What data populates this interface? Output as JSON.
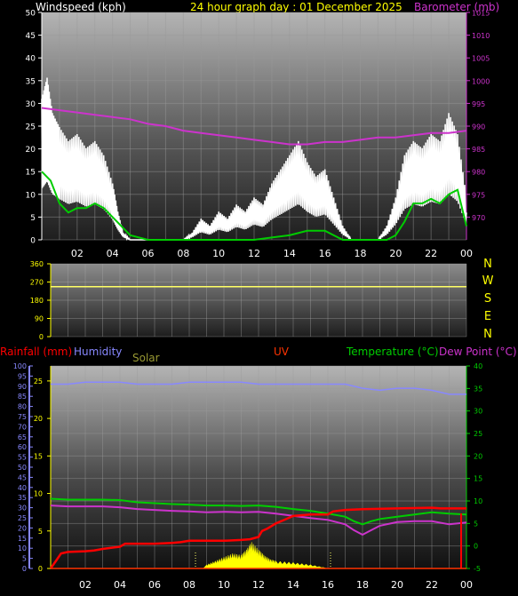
{
  "header": {
    "windspeed_label": "Windspeed (kph)",
    "title": "24 hour graph day : 01 December 2025",
    "barometer_label": "Barometer (mb)"
  },
  "bottom_header": {
    "rainfall_label": "Rainfall (mm)",
    "humidity_label": "Humidity",
    "solar_label": "Solar",
    "uv_label": "UV",
    "temperature_label": "Temperature (°C)",
    "dewpoint_label": "Dew Point (°C)"
  },
  "colors": {
    "windspeed": "#ffffff",
    "wind_avg": "#00cc00",
    "barometer": "#cc33cc",
    "title": "#ffff00",
    "direction": "#ffff66",
    "rainfall": "#ff0000",
    "humidity": "#8888ff",
    "solar": "#ffff00",
    "uv": "#ff3300",
    "temperature": "#00cc00",
    "dewpoint": "#cc33cc",
    "rain_axis": "#ffff00"
  },
  "chart_data": [
    {
      "type": "line",
      "x_ticks": [
        "02",
        "04",
        "06",
        "08",
        "10",
        "12",
        "14",
        "16",
        "18",
        "20",
        "22",
        "00"
      ],
      "xlim": [
        0,
        24
      ],
      "left_axis": {
        "ticks": [
          "0",
          "5",
          "10",
          "15",
          "20",
          "25",
          "30",
          "35",
          "40",
          "45",
          "50"
        ],
        "ylim": [
          0,
          50
        ]
      },
      "right_axis": {
        "ticks": [
          "970",
          "975",
          "980",
          "985",
          "990",
          "995",
          "1000",
          "1005",
          "1010",
          "1015"
        ],
        "ylim": [
          965,
          1015
        ]
      },
      "series": [
        {
          "key": "wind_gust",
          "x": [
            0,
            0.3,
            0.6,
            1,
            1.5,
            2,
            2.5,
            3,
            3.5,
            4,
            4.3,
            4.6,
            5,
            6,
            7,
            8,
            8.5,
            9,
            9.5,
            10,
            10.5,
            11,
            11.5,
            12,
            12.5,
            13,
            13.5,
            14,
            14.5,
            15,
            15.5,
            16,
            16.5,
            17,
            17.5,
            18,
            18.5,
            19,
            19.5,
            20,
            20.5,
            21,
            21.5,
            22,
            22.5,
            23,
            23.5,
            24
          ],
          "y": [
            20,
            23,
            18,
            16,
            14,
            15,
            13,
            14,
            12,
            8,
            4,
            1,
            0,
            0,
            0,
            0,
            1,
            3,
            2,
            4,
            3,
            5,
            4,
            6,
            5,
            8,
            10,
            12,
            14,
            11,
            9,
            10,
            6,
            2,
            0,
            0,
            0,
            0,
            2,
            6,
            12,
            14,
            13,
            15,
            14,
            18,
            15,
            6
          ]
        },
        {
          "key": "wind_avg",
          "x": [
            0,
            0.5,
            1,
            1.5,
            2,
            2.5,
            3,
            3.5,
            4,
            4.5,
            5,
            6,
            8,
            10,
            12,
            13,
            14,
            15,
            16,
            16.5,
            17,
            18,
            19,
            19.5,
            20,
            20.5,
            21,
            21.5,
            22,
            22.5,
            23,
            23.5,
            24
          ],
          "y": [
            15,
            13,
            8,
            6,
            7,
            7,
            8,
            7,
            5,
            3,
            1,
            0,
            0,
            0,
            0,
            0.5,
            1,
            2,
            2,
            1,
            0,
            0,
            0,
            0,
            1,
            4,
            8,
            8,
            9,
            8,
            10,
            11,
            3
          ]
        },
        {
          "key": "barometer",
          "x": [
            0,
            1,
            2,
            3,
            4,
            5,
            6,
            7,
            8,
            9,
            10,
            11,
            12,
            13,
            14,
            15,
            16,
            17,
            18,
            19,
            20,
            21,
            22,
            23,
            24
          ],
          "y": [
            994,
            993.5,
            993,
            992.5,
            992,
            991.5,
            990.5,
            990,
            989,
            988.5,
            988,
            987.5,
            987,
            986.5,
            986,
            986,
            986.5,
            986.5,
            987,
            987.5,
            987.5,
            988,
            988.5,
            988.5,
            989
          ]
        }
      ]
    },
    {
      "type": "line",
      "x_ticks": [],
      "xlim": [
        0,
        24
      ],
      "left_axis": {
        "ticks": [
          "0",
          "90",
          "180",
          "270",
          "360"
        ],
        "ylim": [
          0,
          360
        ]
      },
      "direction_labels": [
        "N",
        "W",
        "S",
        "E",
        "N"
      ],
      "series": [
        {
          "key": "wind_direction",
          "x": [
            0,
            24
          ],
          "y": [
            247,
            247
          ]
        }
      ]
    },
    {
      "type": "line",
      "x_ticks": [
        "02",
        "04",
        "06",
        "08",
        "10",
        "12",
        "14",
        "16",
        "18",
        "20",
        "22",
        "00"
      ],
      "xlim": [
        0,
        24
      ],
      "humidity_axis": {
        "ticks": [
          "0",
          "5",
          "10",
          "15",
          "20",
          "25",
          "30",
          "35",
          "40",
          "45",
          "50",
          "55",
          "60",
          "65",
          "70",
          "75",
          "80",
          "85",
          "90",
          "95",
          "100"
        ],
        "ylim": [
          0,
          100
        ]
      },
      "rain_axis": {
        "ticks": [
          "0",
          "5",
          "10",
          "15",
          "20",
          "25"
        ],
        "ylim": [
          0,
          27
        ]
      },
      "temp_axis": {
        "ticks": [
          "-5",
          "0",
          "5",
          "10",
          "15",
          "20",
          "25",
          "30",
          "35",
          "40"
        ],
        "ylim": [
          -5,
          40
        ]
      },
      "series": [
        {
          "key": "humidity",
          "x": [
            0,
            1,
            2,
            3,
            4,
            5,
            6,
            7,
            8,
            9,
            10,
            11,
            12,
            13,
            14,
            15,
            16,
            17,
            17.5,
            18,
            19,
            20,
            21,
            22,
            23,
            24
          ],
          "y": [
            91,
            91,
            92,
            92,
            92,
            91,
            91,
            91,
            92,
            92,
            92,
            92,
            91,
            91,
            91,
            91,
            91,
            91,
            90,
            89,
            88,
            89,
            89,
            88,
            86,
            86
          ]
        },
        {
          "key": "temperature",
          "x": [
            0,
            1,
            2,
            3,
            4,
            5,
            6,
            7,
            8,
            9,
            10,
            11,
            12,
            13,
            14,
            15,
            16,
            17,
            17.5,
            18,
            18.5,
            19,
            20,
            21,
            22,
            23,
            24
          ],
          "y": [
            10.5,
            10.3,
            10.3,
            10.3,
            10.2,
            9.7,
            9.5,
            9.3,
            9.2,
            9.0,
            9.0,
            8.9,
            9.0,
            8.7,
            8.2,
            7.8,
            7.2,
            6.5,
            5.5,
            4.8,
            5.5,
            6.0,
            6.5,
            7.0,
            7.5,
            7.2,
            7.0
          ]
        },
        {
          "key": "dewpoint",
          "x": [
            0,
            1,
            2,
            3,
            4,
            5,
            6,
            7,
            8,
            9,
            10,
            11,
            12,
            13,
            14,
            15,
            16,
            17,
            17.5,
            18,
            18.5,
            19,
            20,
            21,
            22,
            23,
            24
          ],
          "y": [
            9.0,
            8.8,
            8.8,
            8.8,
            8.6,
            8.2,
            8.0,
            7.8,
            7.7,
            7.5,
            7.6,
            7.5,
            7.6,
            7.2,
            6.7,
            6.2,
            5.8,
            4.8,
            3.5,
            2.5,
            3.5,
            4.5,
            5.3,
            5.5,
            5.5,
            4.8,
            5.2
          ]
        },
        {
          "key": "rainfall",
          "x": [
            0,
            0.3,
            0.6,
            1,
            2,
            2.5,
            3,
            4,
            4.3,
            6,
            7,
            7.5,
            8,
            10,
            11,
            11.5,
            12,
            12.2,
            12.5,
            13,
            13.5,
            14,
            15,
            16,
            16.3,
            17,
            18,
            20,
            22,
            22.5,
            24
          ],
          "y": [
            0,
            1,
            2,
            2.2,
            2.3,
            2.4,
            2.6,
            2.9,
            3.3,
            3.3,
            3.4,
            3.5,
            3.7,
            3.7,
            3.8,
            3.9,
            4.2,
            5.0,
            5.3,
            6.0,
            6.5,
            7.0,
            7.2,
            7.2,
            7.6,
            7.8,
            7.9,
            8.0,
            8.1,
            8.0,
            8.0
          ]
        },
        {
          "key": "solar",
          "x": [
            8.8,
            9,
            9.5,
            10,
            10.5,
            11,
            11.3,
            11.6,
            12,
            12.3,
            12.7,
            13,
            14,
            15,
            16
          ],
          "y": [
            0,
            0.5,
            1.0,
            1.5,
            2.0,
            1.8,
            2.5,
            3.5,
            2.5,
            1.8,
            1.2,
            1.0,
            0.8,
            0.5,
            0
          ]
        }
      ]
    }
  ]
}
